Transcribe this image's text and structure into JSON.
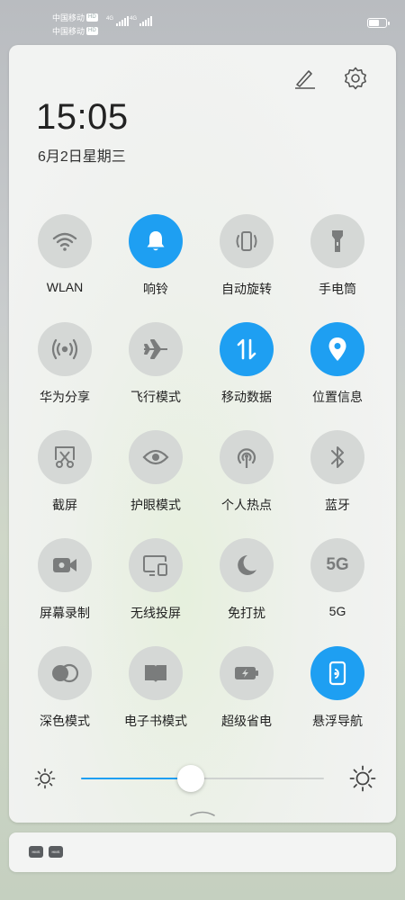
{
  "status_bar": {
    "carrier1": "中国移动",
    "carrier2": "中国移动",
    "hd": "HD",
    "net1": "4G",
    "net2": "4G"
  },
  "panel": {
    "time": "15:05",
    "date": "6月2日星期三"
  },
  "toggles": [
    {
      "label": "WLAN",
      "icon": "wifi-icon",
      "active": false
    },
    {
      "label": "响铃",
      "icon": "bell-icon",
      "active": true
    },
    {
      "label": "自动旋转",
      "icon": "rotate-icon",
      "active": false
    },
    {
      "label": "手电筒",
      "icon": "flashlight-icon",
      "active": false
    },
    {
      "label": "华为分享",
      "icon": "share-icon",
      "active": false
    },
    {
      "label": "飞行模式",
      "icon": "airplane-icon",
      "active": false
    },
    {
      "label": "移动数据",
      "icon": "mobile-data-icon",
      "active": true
    },
    {
      "label": "位置信息",
      "icon": "location-icon",
      "active": true
    },
    {
      "label": "截屏",
      "icon": "screenshot-icon",
      "active": false
    },
    {
      "label": "护眼模式",
      "icon": "eye-icon",
      "active": false
    },
    {
      "label": "个人热点",
      "icon": "hotspot-icon",
      "active": false
    },
    {
      "label": "蓝牙",
      "icon": "bluetooth-icon",
      "active": false
    },
    {
      "label": "屏幕录制",
      "icon": "screen-record-icon",
      "active": false
    },
    {
      "label": "无线投屏",
      "icon": "wireless-projection-icon",
      "active": false
    },
    {
      "label": "免打扰",
      "icon": "moon-icon",
      "active": false
    },
    {
      "label": "5G",
      "icon": "5g-icon",
      "active": false,
      "icon_text": "5G"
    },
    {
      "label": "深色模式",
      "icon": "dark-mode-icon",
      "active": false
    },
    {
      "label": "电子书模式",
      "icon": "ebook-icon",
      "active": false
    },
    {
      "label": "超级省电",
      "icon": "battery-saver-icon",
      "active": false
    },
    {
      "label": "悬浮导航",
      "icon": "floating-nav-icon",
      "active": true
    }
  ],
  "brightness": {
    "level": 0.45
  },
  "notification": {
    "icons": [
      "hms-icon",
      "hms-icon"
    ],
    "icon_text": "HMS"
  },
  "colors": {
    "accent": "#1e9ff2",
    "inactive": "#d5d8d6",
    "icon_gray": "#7a7c7c"
  }
}
